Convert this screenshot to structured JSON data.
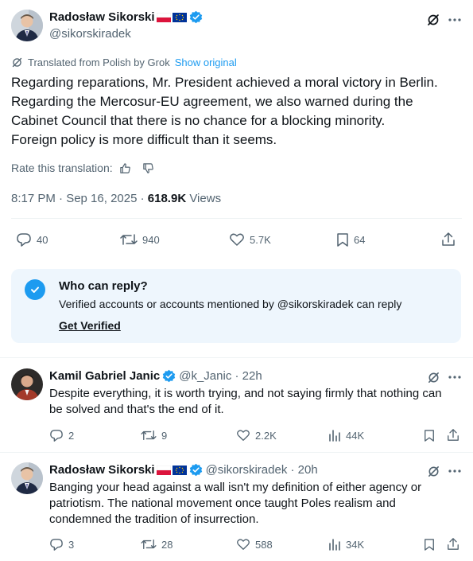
{
  "main_post": {
    "author_name": "Radosław Sikorski",
    "handle": "@sikorskiradek",
    "translated_note": "Translated from Polish by Grok",
    "show_original": "Show original",
    "text_lines": [
      "Regarding reparations, Mr. President achieved a moral victory in Berlin.",
      "Regarding the Mercosur-EU agreement, we also warned during the",
      "Cabinet Council that there is no chance for a blocking minority.",
      "Foreign policy is more difficult than it seems."
    ],
    "rate_translation": "Rate this translation:",
    "timestamp": "8:17 PM · Sep 16, 2025 · ",
    "views_count": "618.9K",
    "views_label": "Views",
    "actions": {
      "replies": "40",
      "reposts": "940",
      "likes": "5.7K",
      "bookmarks": "64"
    }
  },
  "reply_notice": {
    "title": "Who can reply?",
    "body": "Verified accounts or accounts mentioned by @sikorskiradek can reply",
    "cta": "Get Verified"
  },
  "replies": [
    {
      "author_name": "Kamil Gabriel Janic",
      "handle_time": "@k_Janic · 22h",
      "text_lines": [
        "Despite everything, it is worth trying, and not saying firmly that nothing can",
        "be solved and that's the end of it."
      ],
      "replies": "2",
      "reposts": "9",
      "likes": "2.2K",
      "views": "44K"
    },
    {
      "author_name": "Radosław Sikorski",
      "handle_time": "@sikorskiradek · 20h",
      "text_lines": [
        "Banging your head against a wall isn't my definition of either agency or",
        "patriotism. The national movement once taught Poles realism and",
        "condemned the tradition of insurrection."
      ],
      "replies": "3",
      "reposts": "28",
      "likes": "588",
      "views": "34K"
    }
  ],
  "colors": {
    "accent": "#1d9bf0",
    "secondary_text": "#536471",
    "notice_bg": "#eef6fd"
  }
}
